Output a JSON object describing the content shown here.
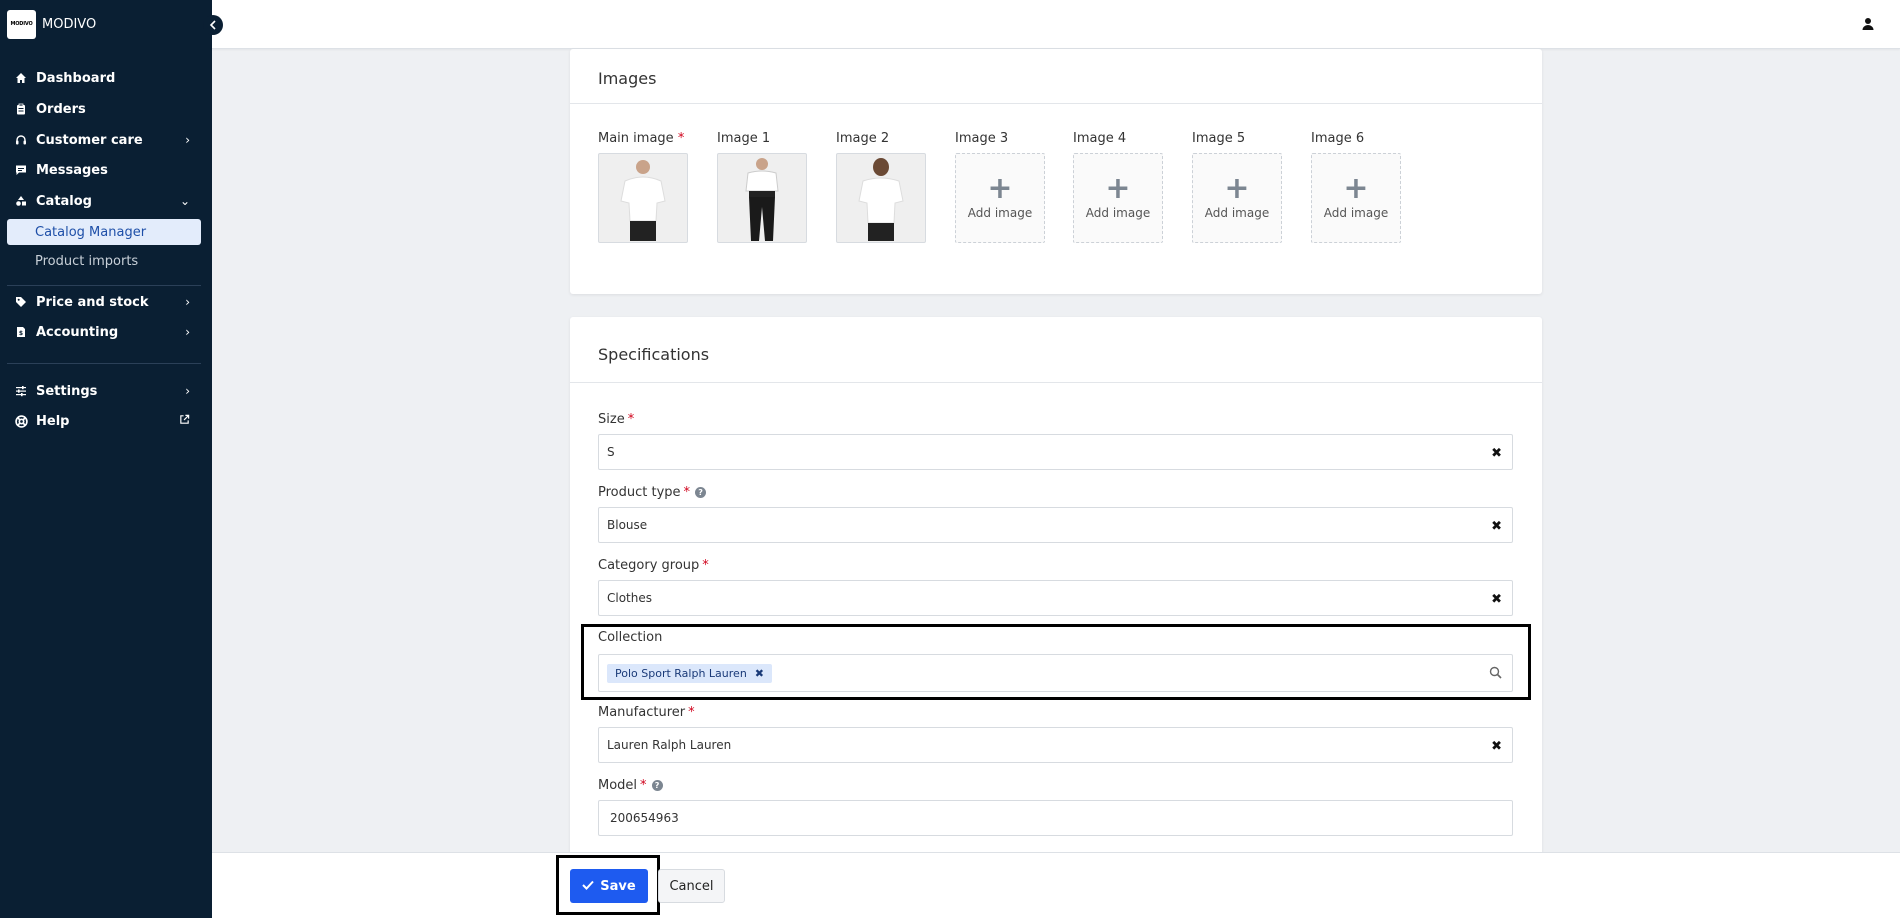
{
  "brand": {
    "logo_text": "MODIVO",
    "name": "MODIVO"
  },
  "sidebar": {
    "items": [
      {
        "label": "Dashboard",
        "icon": "home-icon"
      },
      {
        "label": "Orders",
        "icon": "clipboard-icon"
      },
      {
        "label": "Customer care",
        "icon": "headset-icon"
      },
      {
        "label": "Messages",
        "icon": "message-icon"
      },
      {
        "label": "Catalog",
        "icon": "shapes-icon"
      },
      {
        "label": "Price and stock",
        "icon": "tag-icon"
      },
      {
        "label": "Accounting",
        "icon": "invoice-icon"
      },
      {
        "label": "Settings",
        "icon": "sliders-icon"
      },
      {
        "label": "Help",
        "icon": "lifebuoy-icon"
      }
    ],
    "catalog_sub": [
      "Catalog Manager",
      "Product imports"
    ]
  },
  "images_section": {
    "title": "Images",
    "slots": [
      {
        "label": "Main image",
        "required": "*",
        "ellipsis": " ...",
        "filled": true
      },
      {
        "label": "Image 1",
        "filled": true
      },
      {
        "label": "Image 2",
        "filled": true
      },
      {
        "label": "Image 3",
        "filled": false
      },
      {
        "label": "Image 4",
        "filled": false
      },
      {
        "label": "Image 5",
        "filled": false
      },
      {
        "label": "Image 6",
        "filled": false
      }
    ],
    "add_label": "Add image"
  },
  "specifications": {
    "title": "Specifications",
    "size": {
      "label": "Size",
      "value": "S"
    },
    "product_type": {
      "label": "Product type",
      "value": "Blouse"
    },
    "category_group": {
      "label": "Category group",
      "value": "Clothes"
    },
    "collection": {
      "label": "Collection",
      "chip": "Polo Sport Ralph Lauren"
    },
    "manufacturer": {
      "label": "Manufacturer",
      "value": "Lauren Ralph Lauren"
    },
    "model": {
      "label": "Model",
      "value": "200654963"
    }
  },
  "footer": {
    "save_label": "Save",
    "cancel_label": "Cancel"
  },
  "colors": {
    "sidebar_bg": "#0a1f33",
    "primary": "#1e5bf0",
    "required": "#d0021b",
    "chip_bg": "#dbe7fb"
  }
}
